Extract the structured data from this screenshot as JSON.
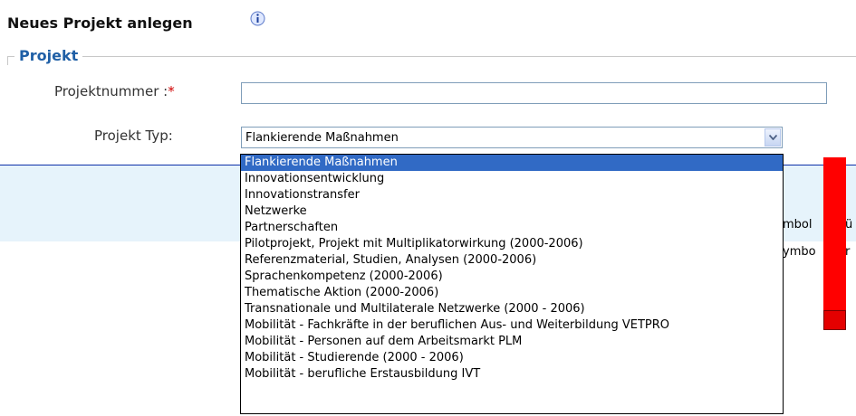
{
  "header": {
    "title": "Neues Projekt anlegen"
  },
  "icons": {
    "info": "info-icon"
  },
  "section": {
    "legend": "Projekt"
  },
  "form": {
    "projektnummer_label": "Projektnummer :",
    "required_marker": "*",
    "projektnummer_value": "",
    "projekt_typ_label": "Projekt Typ:",
    "projekt_typ_selected": "Flankierende Maßnahmen"
  },
  "dropdown": {
    "options": [
      "Flankierende Maßnahmen",
      "Innovationsentwicklung",
      "Innovationstransfer",
      "Netzwerke",
      "Partnerschaften",
      "Pilotprojekt, Projekt mit Multiplikatorwirkung (2000-2006)",
      "Referenzmaterial, Studien, Analysen (2000-2006)",
      "Sprachenkompetenz (2000-2006)",
      "Thematische Aktion (2000-2006)",
      "Transnationale und Multilaterale Netzwerke (2000 - 2006)",
      "Mobilität - Fachkräfte in der beruflichen Aus- und Weiterbildung VETPRO",
      "Mobilität - Personen auf dem Arbeitsmarkt PLM",
      "Mobilität - Studierende (2000 - 2006)",
      "Mobilität - berufliche Erstausbildung IVT"
    ],
    "selected_index": 0
  },
  "background_text": {
    "line1": "mbol",
    "line1_tail": "ü",
    "line2": "ymbo",
    "line2_tail": "r"
  },
  "colors": {
    "accent": "#1f5fa6",
    "selection": "#316ac5",
    "band": "#e6f3fb",
    "alert": "#ff0000"
  }
}
